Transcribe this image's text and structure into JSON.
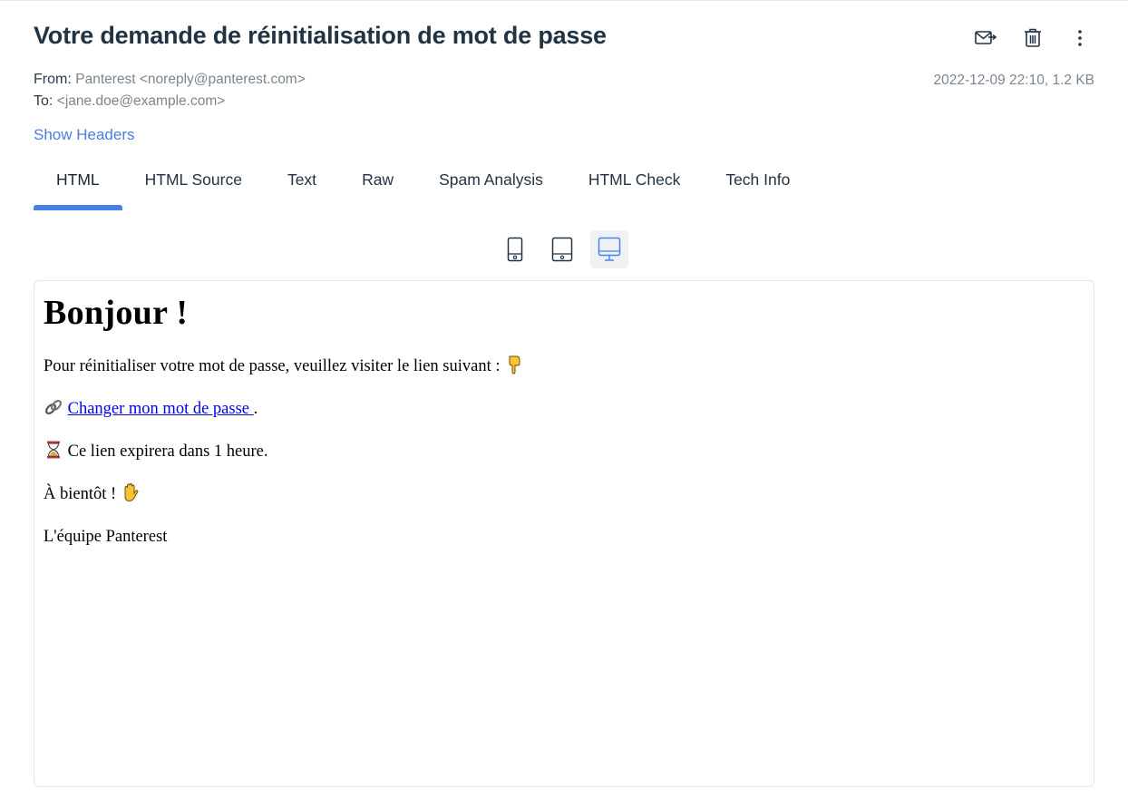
{
  "email": {
    "subject": "Votre demande de réinitialisation de mot de passe",
    "from_label": "From:",
    "from_value": "Panterest <noreply@panterest.com>",
    "to_label": "To:",
    "to_value": "<jane.doe@example.com>",
    "date_size": "2022-12-09 22:10, 1.2 KB",
    "show_headers": "Show Headers"
  },
  "actions": [
    {
      "icon": "forward-mail-icon"
    },
    {
      "icon": "trash-icon"
    },
    {
      "icon": "more-vertical-icon"
    }
  ],
  "tabs": [
    {
      "label": "HTML",
      "active": true
    },
    {
      "label": "HTML Source"
    },
    {
      "label": "Text"
    },
    {
      "label": "Raw"
    },
    {
      "label": "Spam Analysis"
    },
    {
      "label": "HTML Check"
    },
    {
      "label": "Tech Info"
    }
  ],
  "devices": [
    {
      "icon": "mobile-icon"
    },
    {
      "icon": "tablet-icon"
    },
    {
      "icon": "desktop-icon",
      "active": true
    }
  ],
  "body": {
    "heading": "Bonjour !",
    "line1": "Pour réinitialiser votre mot de passe, veuillez visiter le lien suivant :",
    "link_text": "Changer mon mot de passe ",
    "link_suffix": ".",
    "line3": "Ce lien expirera dans 1 heure.",
    "line4": "À bientôt !",
    "signature": "L'équipe Panterest"
  },
  "colors": {
    "accent": "#4a80e0",
    "link": "#0000ee"
  }
}
